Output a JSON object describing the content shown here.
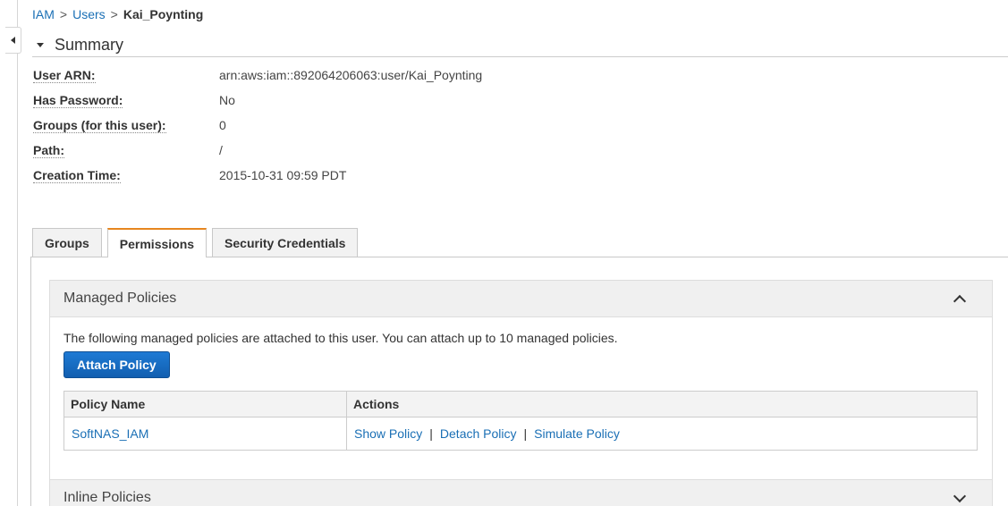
{
  "breadcrumb": {
    "root": "IAM",
    "sep1": ">",
    "users": "Users",
    "sep2": ">",
    "current": "Kai_Poynting"
  },
  "summary": {
    "title": "Summary",
    "fields": [
      {
        "key": "User ARN:",
        "value": "arn:aws:iam::892064206063:user/Kai_Poynting"
      },
      {
        "key": "Has Password:",
        "value": "No"
      },
      {
        "key": "Groups (for this user):",
        "value": "0"
      },
      {
        "key": "Path:",
        "value": "/"
      },
      {
        "key": "Creation Time:",
        "value": "2015-10-31 09:59 PDT"
      }
    ]
  },
  "tabs": [
    {
      "label": "Groups",
      "active": false
    },
    {
      "label": "Permissions",
      "active": true
    },
    {
      "label": "Security Credentials",
      "active": false
    }
  ],
  "managed_policies": {
    "title": "Managed Policies",
    "description": "The following managed policies are attached to this user. You can attach up to 10 managed policies.",
    "attach_button": "Attach Policy",
    "columns": [
      "Policy Name",
      "Actions"
    ],
    "rows": [
      {
        "name": "SoftNAS_IAM",
        "actions": [
          "Show Policy",
          "Detach Policy",
          "Simulate Policy"
        ],
        "separator": "|"
      }
    ]
  },
  "inline_policies": {
    "title": "Inline Policies"
  },
  "icons": {
    "sidebar_toggle": "caret-left-icon",
    "summary_toggle": "caret-down-icon",
    "managed_collapse": "chevron-up-icon",
    "inline_expand": "chevron-down-icon"
  },
  "colors": {
    "link": "#1a6fb5",
    "active_tab_accent": "#e7861f",
    "primary_button": "#1e7ad4"
  }
}
